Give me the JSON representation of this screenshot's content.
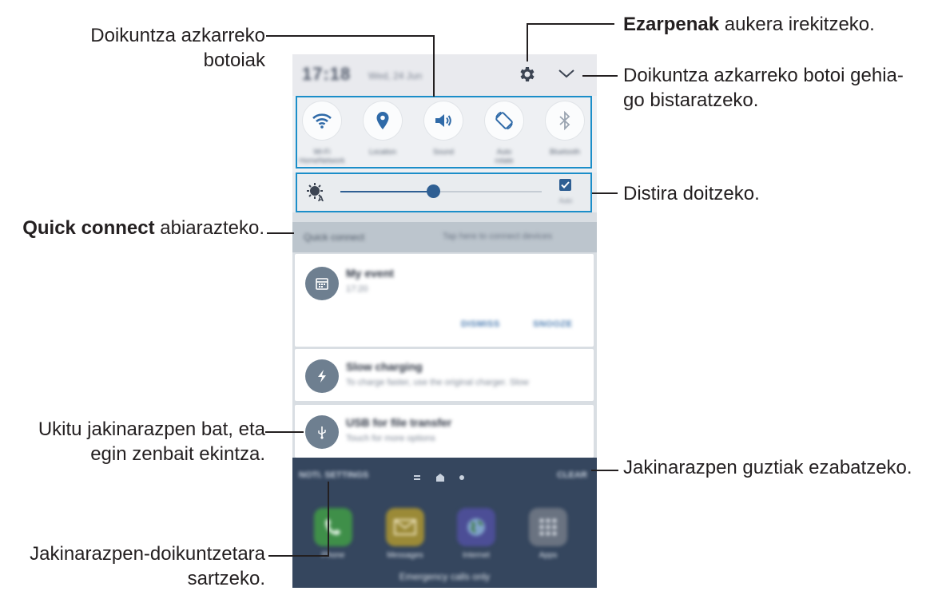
{
  "callouts": {
    "quick_buttons": "Doikuntza azkarreko\nbotoiak",
    "settings_bold": "Ezarpenak",
    "settings_rest": " aukera irekitzeko.",
    "more_buttons": "Doikuntza azkarreko botoi gehia-\ngo bistaratzeko.",
    "brightness": "Distira doitzeko.",
    "quick_connect_bold": "Quick connect",
    "quick_connect_rest": " abiarazteko.",
    "tap_notification": "Ukitu jakinarazpen bat, eta\negin zenbait ekintza.",
    "clear_all": "Jakinarazpen guztiak ezabatzeko.",
    "notif_settings": "Jakinarazpen-doikuntzetara\nsartzeko."
  },
  "status_bar": {
    "time": "17:18",
    "date": "Wed, 24 Jun"
  },
  "quick_settings": [
    {
      "label": "Wi-Fi",
      "sub": "HomeNetwork",
      "icon": "wifi-icon"
    },
    {
      "label": "Location",
      "sub": "",
      "icon": "location-icon"
    },
    {
      "label": "Sound",
      "sub": "",
      "icon": "sound-icon"
    },
    {
      "label": "Auto",
      "sub": "rotate",
      "icon": "rotate-icon"
    },
    {
      "label": "Bluetooth",
      "sub": "",
      "icon": "bluetooth-icon"
    }
  ],
  "brightness": {
    "level": 0.46,
    "auto_label": "Auto"
  },
  "quick_connect": {
    "label": "Quick connect",
    "hint": "Tap here to connect devices"
  },
  "notifications": [
    {
      "title": "My event",
      "sub": "17:20",
      "icon": "calendar-icon",
      "actions": [
        "DISMISS",
        "SNOOZE"
      ]
    },
    {
      "title": "Slow charging",
      "sub": "To charge faster, use the original charger. Slow",
      "icon": "charging-icon"
    },
    {
      "title": "USB for file transfer",
      "sub": "Touch for more options",
      "icon": "usb-icon"
    }
  ],
  "bottom_bar": {
    "notif_settings": "NOTI. SETTINGS",
    "clear": "CLEAR"
  },
  "apps": [
    {
      "label": "Phone",
      "color": "#3f8f49",
      "icon": "phone-icon"
    },
    {
      "label": "Messages",
      "color": "#9b8a37",
      "icon": "messages-icon"
    },
    {
      "label": "Internet",
      "color": "#4c4e96",
      "icon": "internet-icon"
    },
    {
      "label": "Apps",
      "color": "#6a7381",
      "icon": "apps-icon"
    }
  ],
  "emergency": "Emergency calls only",
  "colors": {
    "highlight": "#1b8ec9",
    "accent": "#2f5f93",
    "dark_bg": "#35465e"
  }
}
